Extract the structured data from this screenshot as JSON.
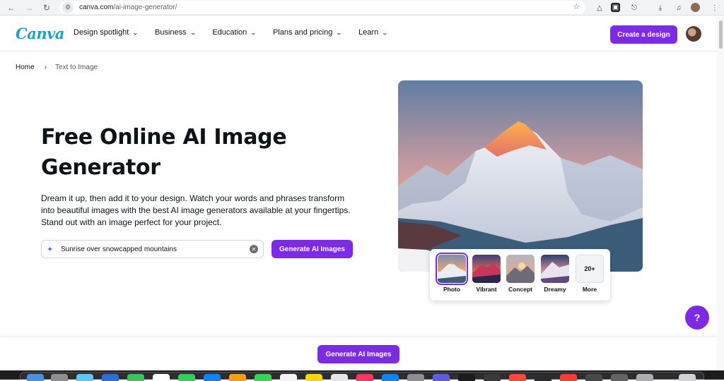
{
  "browser": {
    "url_host": "canva.com",
    "url_path": "/ai-image-generator/",
    "icons": [
      "back-arrow-icon",
      "forward-arrow-icon",
      "reload-icon",
      "site-settings-icon",
      "bookmark-star-icon",
      "download-icon",
      "media-icon",
      "menu-dots-icon"
    ]
  },
  "nav": {
    "logo": "Canva",
    "items": [
      {
        "label": "Design spotlight"
      },
      {
        "label": "Business"
      },
      {
        "label": "Education"
      },
      {
        "label": "Plans and pricing"
      },
      {
        "label": "Learn"
      }
    ],
    "cta": "Create a design"
  },
  "breadcrumb": {
    "home": "Home",
    "current": "Text to Image"
  },
  "hero": {
    "title": "Free Online AI Image Generator",
    "description": "Dream it up, then add it to your design. Watch your words and phrases transform into beautiful images with the best AI image generators available at your fingertips. Stand out with an image perfect for your project.",
    "prompt_value": "Sunrise over snowcapped mountains",
    "generate_label": "Generate AI Images"
  },
  "styles": [
    {
      "label": "Photo",
      "selected": true
    },
    {
      "label": "Vibrant",
      "selected": false
    },
    {
      "label": "Concept",
      "selected": false
    },
    {
      "label": "Dreamy",
      "selected": false
    },
    {
      "label": "More",
      "badge": "20+",
      "selected": false
    }
  ],
  "help": {
    "label": "?"
  },
  "sticky": {
    "generate_label": "Generate AI Images"
  },
  "colors": {
    "brand_purple": "#7d2ae8",
    "logo_teal": "#18a3c9"
  }
}
